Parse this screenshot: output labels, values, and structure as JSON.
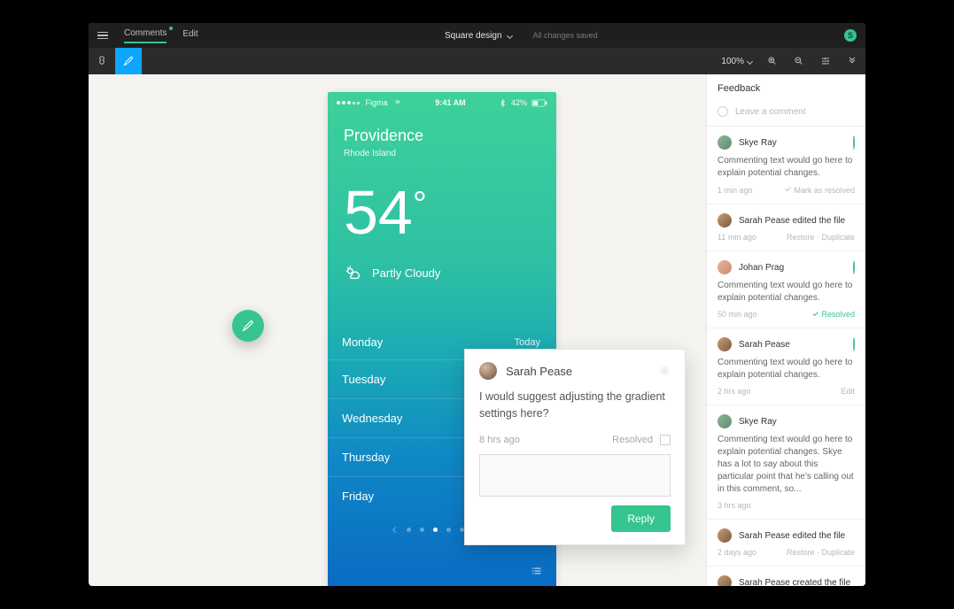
{
  "topbar": {
    "tabs": {
      "comments": "Comments",
      "edit": "Edit"
    },
    "project": "Square design",
    "saved": "All changes saved",
    "avatar_letter": "S"
  },
  "toolrow": {
    "zoom": "100%"
  },
  "phone": {
    "carrier": "Figma",
    "time": "9:41 AM",
    "battery": "42%",
    "city": "Providence",
    "state": "Rhode Island",
    "temp": "54",
    "condition": "Partly Cloudy",
    "today_label": "Today",
    "days": [
      "Monday",
      "Tuesday",
      "Wednesday",
      "Thursday",
      "Friday"
    ]
  },
  "card": {
    "author": "Sarah Pease",
    "text": "I would suggest adjusting the gradient settings here?",
    "time": "8 hrs ago",
    "resolved_label": "Resolved",
    "reply": "Reply"
  },
  "side": {
    "title": "Feedback",
    "leave": "Leave a comment",
    "items": [
      {
        "name": "Skye Ray",
        "text": "Commenting text would go here to explain potential changes.",
        "time": "1 min ago",
        "right": "Mark as resolved",
        "right_kind": "mark",
        "ring": true,
        "av": "v4"
      },
      {
        "name": "Sarah Pease edited the file",
        "text": "",
        "time": "11 min ago",
        "right": "Restore · Duplicate",
        "right_kind": "links",
        "ring": false,
        "av": "v1"
      },
      {
        "name": "Johan Prag",
        "text": "Commenting text would go here to explain potential changes.",
        "time": "50 min ago",
        "right": "Resolved",
        "right_kind": "resolved",
        "ring": true,
        "av": "v3"
      },
      {
        "name": "Sarah Pease",
        "text": "Commenting text would go here to explain potential changes.",
        "time": "2 hrs ago",
        "right": "Edit",
        "right_kind": "links",
        "ring": true,
        "av": "v1"
      },
      {
        "name": "Skye Ray",
        "text": "Commenting text would go here to explain potential changes. Skye has a lot to say about this particular point that he's calling out in this comment, so...",
        "time": "3 hrs ago",
        "right": "",
        "right_kind": "",
        "ring": false,
        "av": "v4"
      },
      {
        "name": "Sarah Pease edited the file",
        "text": "",
        "time": "2 days ago",
        "right": "Restore · Duplicate",
        "right_kind": "links",
        "ring": false,
        "av": "v1"
      },
      {
        "name": "Sarah Pease created the file",
        "text": "",
        "time": "",
        "right": "",
        "right_kind": "",
        "ring": false,
        "av": "v1"
      }
    ]
  }
}
